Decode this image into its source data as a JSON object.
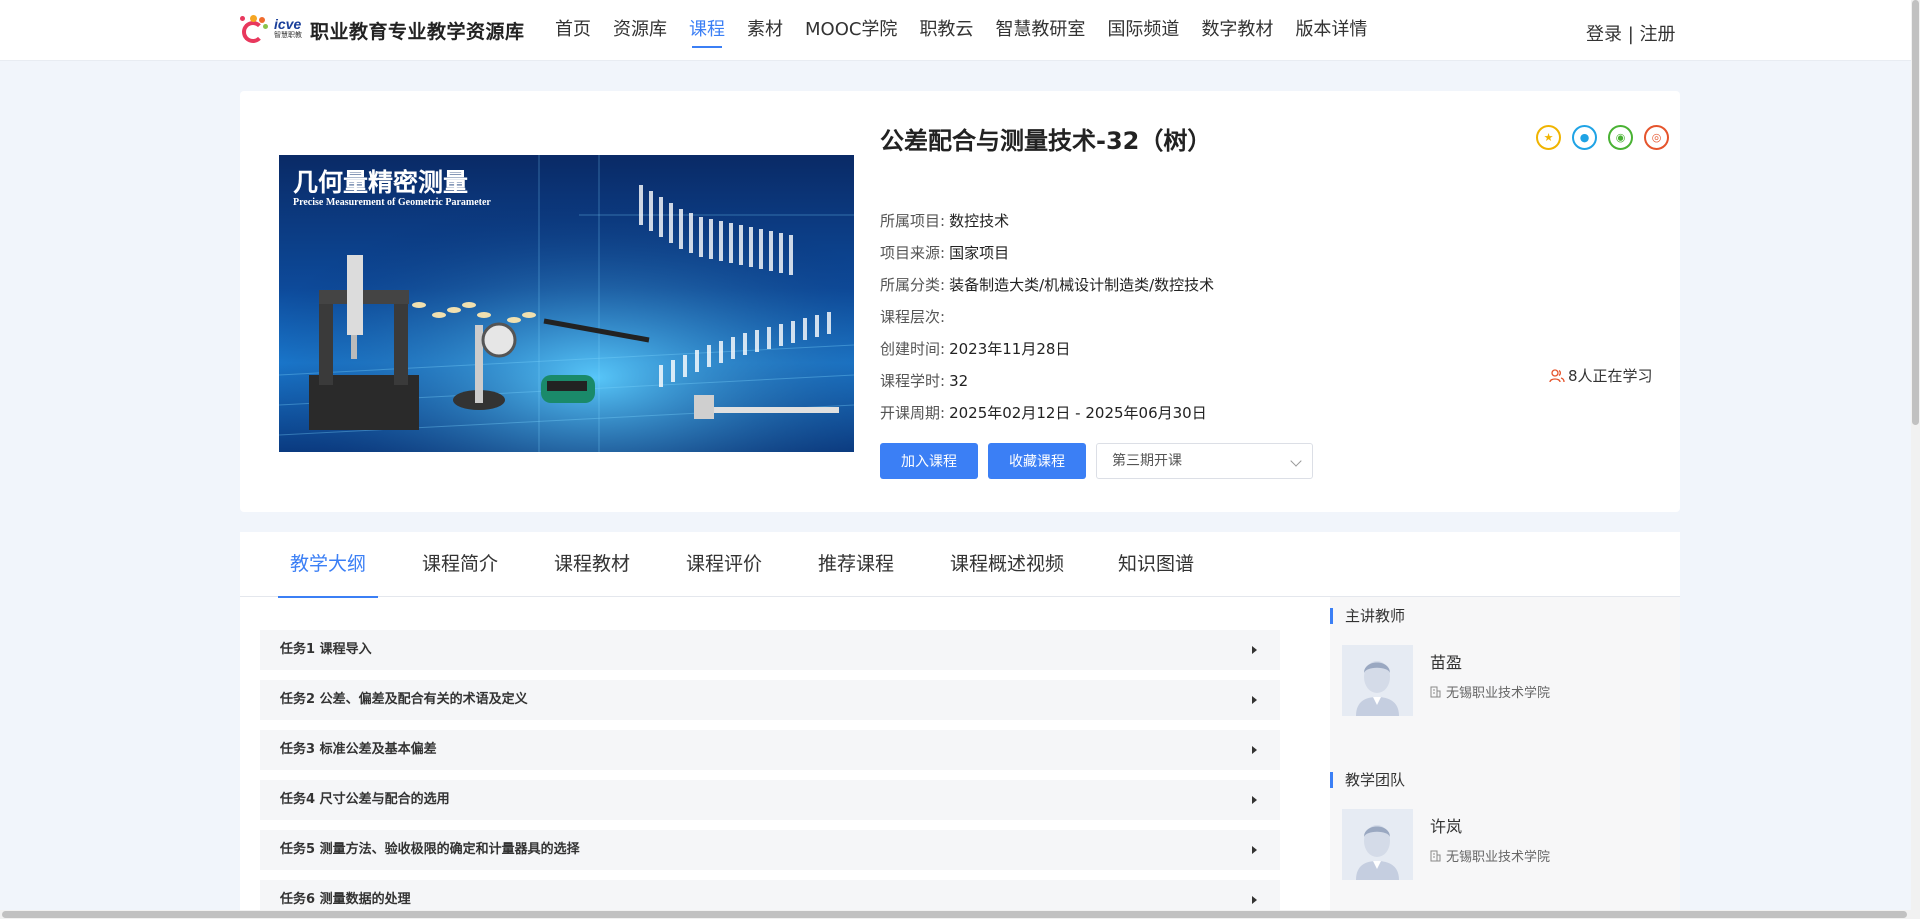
{
  "header": {
    "logo_brand": "icve",
    "logo_brand_sub": "智慧职教",
    "logo_title": "职业教育专业教学资源库",
    "nav": [
      "首页",
      "资源库",
      "课程",
      "素材",
      "MOOC学院",
      "职教云",
      "智慧教研室",
      "国际频道",
      "数字教材",
      "版本详情"
    ],
    "active_nav": "课程",
    "login": "登录",
    "separator": "|",
    "register": "注册"
  },
  "course": {
    "cover_title": "几何量精密测量",
    "cover_subtitle": "Precise Measurement of Geometric Parameter",
    "title": "公差配合与测量技术-32（树）",
    "share_icons": [
      "favorite-icon",
      "qq-icon",
      "wechat-icon",
      "weibo-icon"
    ],
    "info": [
      {
        "key": "所属项目:",
        "value": "数控技术"
      },
      {
        "key": "项目来源:",
        "value": "国家项目"
      },
      {
        "key": "所属分类:",
        "value": "装备制造大类/机械设计制造类/数控技术"
      },
      {
        "key": "课程层次:",
        "value": ""
      },
      {
        "key": "创建时间:",
        "value": "2023年11月28日"
      },
      {
        "key": "课程学时:",
        "value": "32"
      },
      {
        "key": "开课周期:",
        "value": "2025年02月12日 - 2025年06月30日"
      }
    ],
    "learning_count": "8人正在学习",
    "join_label": "加入课程",
    "collect_label": "收藏课程",
    "term_selected": "第三期开课"
  },
  "tabs": [
    "教学大纲",
    "课程简介",
    "课程教材",
    "课程评价",
    "推荐课程",
    "课程概述视频",
    "知识图谱"
  ],
  "active_tab": "教学大纲",
  "syllabus": [
    "任务1 课程导入",
    "任务2 公差、偏差及配合有关的术语及定义",
    "任务3 标准公差及基本偏差",
    "任务4 尺寸公差与配合的选用",
    "任务5 测量方法、验收极限的确定和计量器具的选择",
    "任务6 测量数据的处理"
  ],
  "sidebar": {
    "lead_heading": "主讲教师",
    "lead_teacher": {
      "name": "苗盈",
      "school": "无锡职业技术学院"
    },
    "team_heading": "教学团队",
    "team_teacher": {
      "name": "许岚",
      "school": "无锡职业技术学院"
    }
  },
  "colors": {
    "accent": "#3b7ff5",
    "page_bg": "#f1f5fb"
  }
}
